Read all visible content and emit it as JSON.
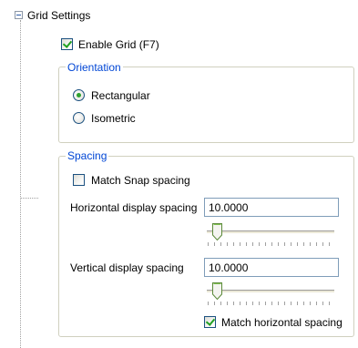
{
  "tree": {
    "node_label": "Grid Settings",
    "expanded": true
  },
  "enable_grid": {
    "label": "Enable Grid (F7)",
    "checked": true
  },
  "orientation": {
    "legend": "Orientation",
    "options": [
      {
        "label": "Rectangular",
        "selected": true
      },
      {
        "label": "Isometric",
        "selected": false
      }
    ]
  },
  "spacing": {
    "legend": "Spacing",
    "match_snap": {
      "label": "Match Snap spacing",
      "checked": false
    },
    "horizontal": {
      "label": "Horizontal display spacing",
      "value": "10.0000",
      "slider_position": 0.09
    },
    "vertical": {
      "label": "Vertical display spacing",
      "value": "10.0000",
      "slider_position": 0.09
    },
    "match_horizontal": {
      "label": "Match horizontal spacing",
      "checked": true
    }
  },
  "colors": {
    "legend_text": "#0046d5",
    "group_border": "#d0d0bf",
    "checkmark": "#21a121",
    "control_border": "#1c5180",
    "textbox_border": "#7f9db9"
  }
}
